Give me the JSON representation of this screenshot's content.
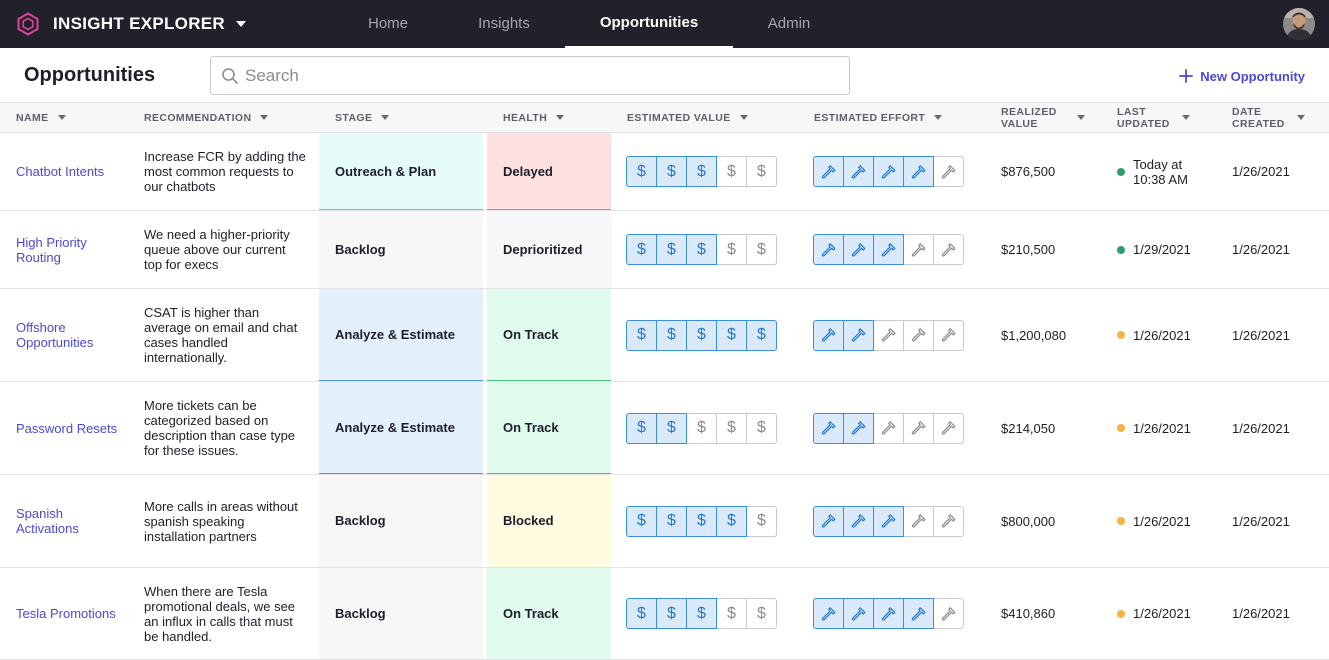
{
  "app": {
    "name": "INSIGHT EXPLORER",
    "brand_color": "#e0439d"
  },
  "nav": {
    "tabs": [
      {
        "label": "Home"
      },
      {
        "label": "Insights"
      },
      {
        "label": "Opportunities",
        "active": true
      },
      {
        "label": "Admin"
      }
    ]
  },
  "page": {
    "title": "Opportunities",
    "search_placeholder": "Search",
    "new_button_label": "New Opportunity",
    "accent": "#4b49d6"
  },
  "table": {
    "columns": {
      "name": "NAME",
      "recommendation": "RECOMMENDATION",
      "stage": "STAGE",
      "health": "HEALTH",
      "estimated_value": "ESTIMATED VALUE",
      "estimated_effort": "ESTIMATED EFFORT",
      "realized_value_1": "REALIZED",
      "realized_value_2": "VALUE",
      "last_updated_1": "LAST",
      "last_updated_2": "UPDATED",
      "date_created_1": "DATE",
      "date_created_2": "CREATED"
    },
    "rows": [
      {
        "name": "Chatbot Intents",
        "recommendation": "Increase FCR by adding the most common requests to our chatbots",
        "stage": "Outreach & Plan",
        "stage_color": "#e6fcfb",
        "stage_border": "#5fd0c9",
        "health": "Delayed",
        "health_color": "#fde1e1",
        "health_border": "#e57f7f",
        "est_value": 3,
        "est_effort": 4,
        "realized_value": "$876,500",
        "last_updated": "Today at 10:38 AM",
        "status_color": "#2e9e6f",
        "date_created": "1/26/2021"
      },
      {
        "name": "High Priority Routing",
        "recommendation": "We need a higher-priority queue above our current top for execs",
        "stage": "Backlog",
        "stage_color": "#f7f7f8",
        "stage_border": "#f7f7f8",
        "health": "Deprioritized",
        "health_color": "#f7f7f8",
        "health_border": "#f7f7f8",
        "est_value": 3,
        "est_effort": 3,
        "realized_value": "$210,500",
        "last_updated": "1/29/2021",
        "status_color": "#2e9e6f",
        "date_created": "1/26/2021"
      },
      {
        "name": "Offshore Opportunities",
        "recommendation": "CSAT is higher than average on email and chat cases handled internationally.",
        "stage": "Analyze & Estimate",
        "stage_color": "#e4f0fc",
        "stage_border": "#4f97d6",
        "health": "On Track",
        "health_color": "#e0fbee",
        "health_border": "#4bbf86",
        "est_value": 5,
        "est_effort": 2,
        "realized_value": "$1,200,080",
        "last_updated": "1/26/2021",
        "status_color": "#f5b341",
        "date_created": "1/26/2021"
      },
      {
        "name": "Password Resets",
        "recommendation": "More tickets can be categorized based on description than case type for these issues.",
        "stage": "Analyze & Estimate",
        "stage_color": "#e4f0fc",
        "stage_border": "#4f97d6",
        "health": "On Track",
        "health_color": "#e0fbee",
        "health_border": "#4bbf86",
        "est_value": 2,
        "est_effort": 2,
        "realized_value": "$214,050",
        "last_updated": "1/26/2021",
        "status_color": "#f5b341",
        "date_created": "1/26/2021"
      },
      {
        "name": "Spanish Activations",
        "recommendation": "More calls in areas without spanish speaking installation partners",
        "stage": "Backlog",
        "stage_color": "#f7f7f8",
        "stage_border": "#f7f7f8",
        "health": "Blocked",
        "health_color": "#fffbe0",
        "health_border": "#fffbe0",
        "est_value": 4,
        "est_effort": 3,
        "realized_value": "$800,000",
        "last_updated": "1/26/2021",
        "status_color": "#f5b341",
        "date_created": "1/26/2021"
      },
      {
        "name": "Tesla Promotions",
        "recommendation": "When there are Tesla promotional deals, we see an influx in calls that must be handled.",
        "stage": "Backlog",
        "stage_color": "#f7f7f8",
        "stage_border": "#f7f7f8",
        "health": "On Track",
        "health_color": "#e0fbee",
        "health_border": "#e0fbee",
        "est_value": 3,
        "est_effort": 4,
        "realized_value": "$410,860",
        "last_updated": "1/26/2021",
        "status_color": "#f5b341",
        "date_created": "1/26/2021"
      }
    ]
  },
  "icons": {
    "value_unit": "dollar-icon",
    "effort_unit": "hammer-icon"
  }
}
